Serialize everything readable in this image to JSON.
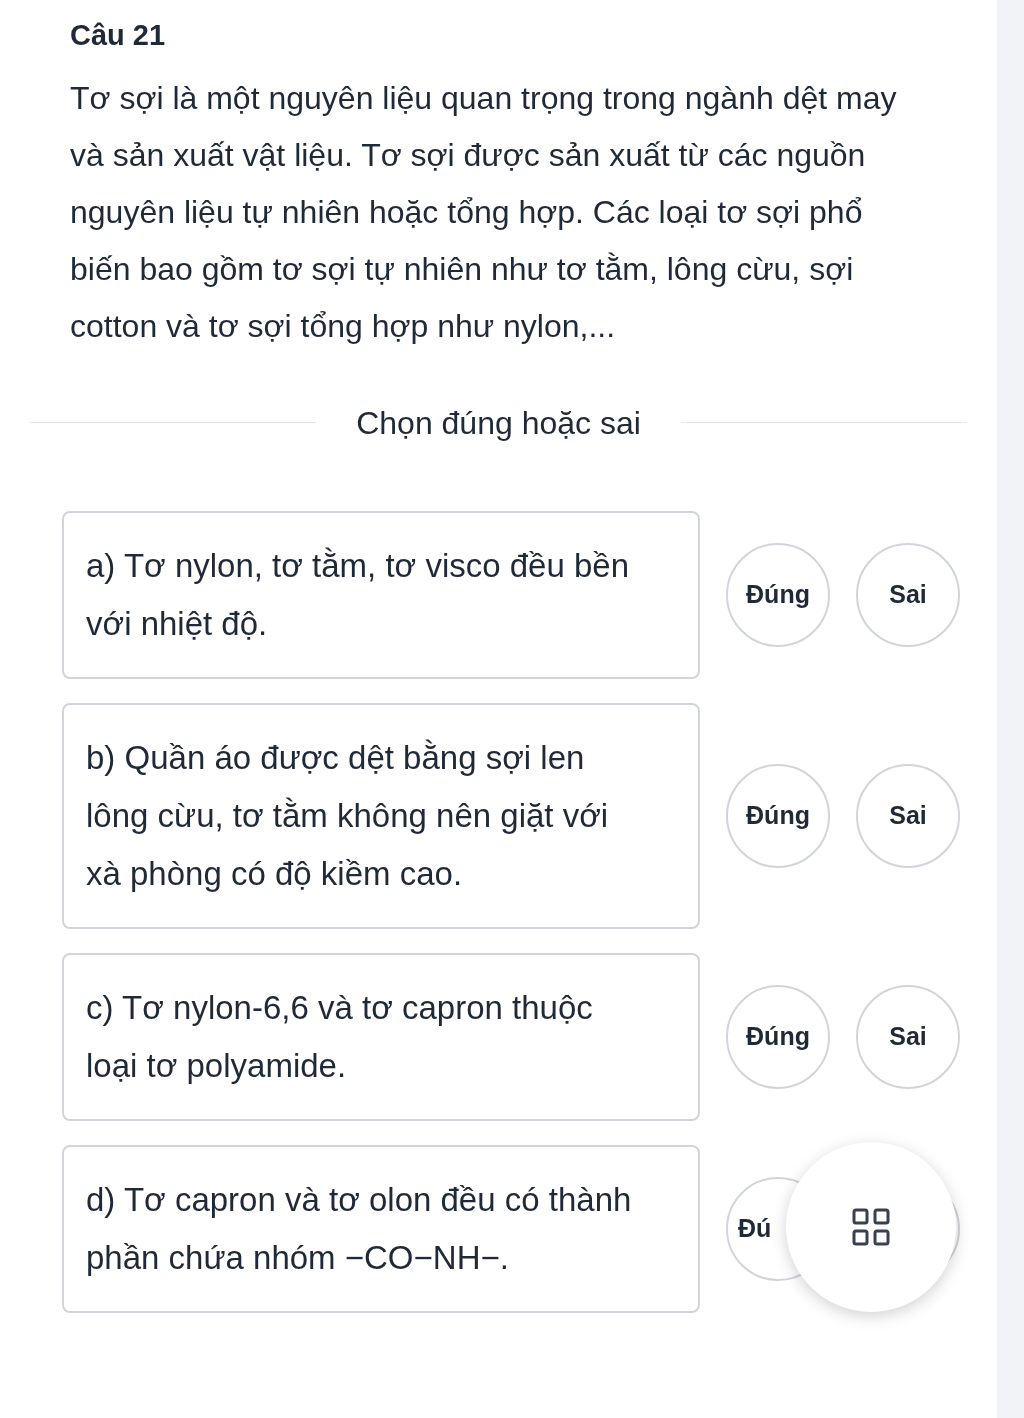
{
  "question": {
    "title": "Câu 21",
    "text": "Tơ sợi là một nguyên liệu quan trọng trong ngành dệt may và sản xuất vật liệu. Tơ sợi được sản xuất từ các nguồn nguyên liệu tự nhiên hoặc tổng hợp. Các loại tơ sợi phổ biến bao gồm tơ sợi tự nhiên như tơ tằm, lông cừu, sợi cotton và tơ sợi tổng hợp như nylon,..."
  },
  "instruction": "Chọn đúng hoặc sai",
  "statements": [
    {
      "text": "a) Tơ nylon, tơ tằm, tơ visco đều bền với nhiệt độ.",
      "options": [
        {
          "label": "Đúng"
        },
        {
          "label": "Sai"
        }
      ]
    },
    {
      "text": "b) Quần áo được dệt bằng sợi len lông cừu, tơ tằm không nên giặt với xà phòng có độ kiềm cao.",
      "options": [
        {
          "label": "Đúng"
        },
        {
          "label": "Sai"
        }
      ]
    },
    {
      "text": "c) Tơ nylon-6,6 và tơ capron thuộc loại tơ polyamide.",
      "options": [
        {
          "label": "Đúng"
        },
        {
          "label": "Sai"
        }
      ]
    },
    {
      "text": "d) Tơ capron và tơ olon đều có thành phần chứa nhóm −CO−NH−.",
      "options": [
        {
          "label": "Đú",
          "covered": true
        },
        {
          "covered": true
        }
      ]
    }
  ]
}
